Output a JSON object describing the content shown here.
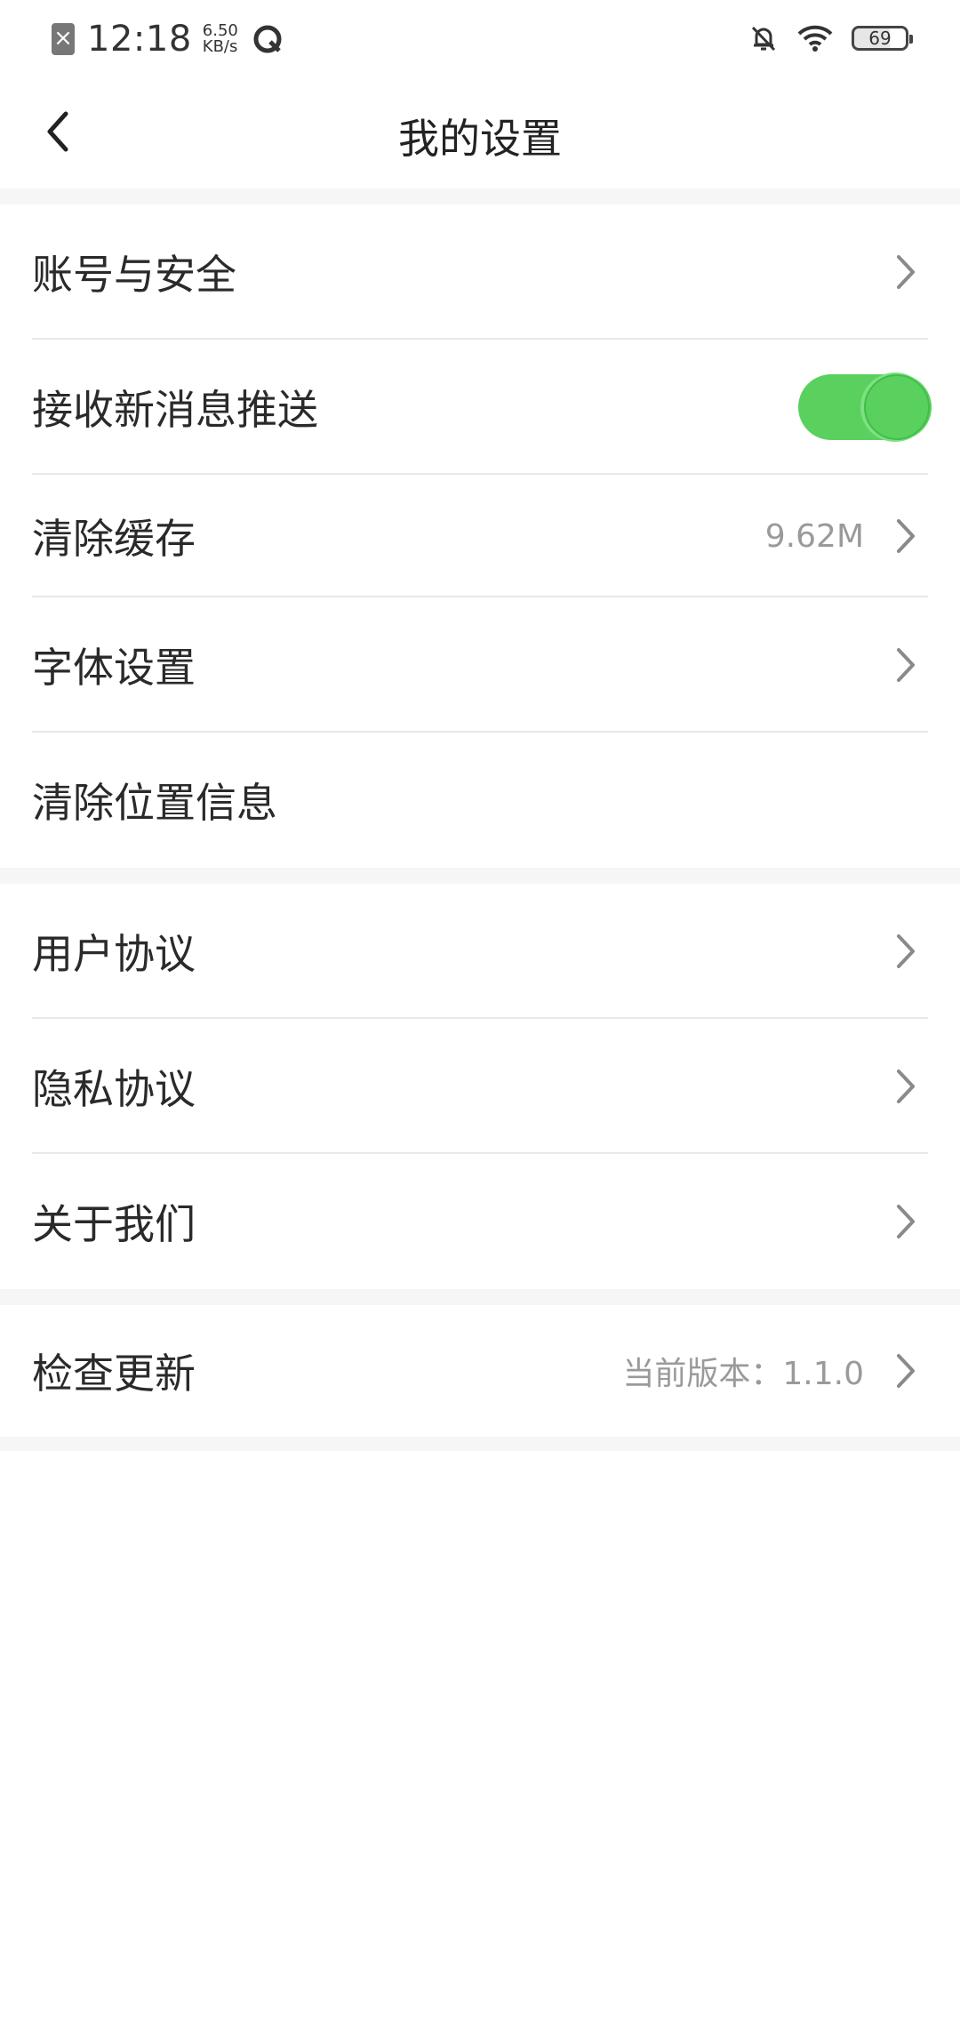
{
  "status_bar": {
    "time": "12:18",
    "speed_value": "6.50",
    "speed_unit": "KB/s",
    "battery": "69",
    "icons": [
      "sim-error-icon",
      "app-q-icon",
      "bell-muted-icon",
      "wifi-icon",
      "battery-icon"
    ]
  },
  "header": {
    "title": "我的设置",
    "back_icon": "chevron-left-icon"
  },
  "groups": [
    {
      "items": [
        {
          "label": "账号与安全",
          "value": "",
          "control": "chevron"
        },
        {
          "label": "接收新消息推送",
          "value": "",
          "control": "toggle",
          "toggle_on": true
        },
        {
          "label": "清除缓存",
          "value": "9.62M",
          "control": "chevron"
        },
        {
          "label": "字体设置",
          "value": "",
          "control": "chevron"
        },
        {
          "label": "清除位置信息",
          "value": "",
          "control": "none"
        }
      ]
    },
    {
      "items": [
        {
          "label": "用户协议",
          "value": "",
          "control": "chevron"
        },
        {
          "label": "隐私协议",
          "value": "",
          "control": "chevron"
        },
        {
          "label": "关于我们",
          "value": "",
          "control": "chevron"
        }
      ]
    },
    {
      "items": [
        {
          "label": "检查更新",
          "value": "当前版本：1.1.0",
          "control": "chevron"
        }
      ]
    }
  ],
  "colors": {
    "toggle_on": "#5ad05f",
    "section_gap": "#f6f6f6",
    "divider": "#e8e8e8",
    "secondary_text": "#9a9a9a"
  }
}
